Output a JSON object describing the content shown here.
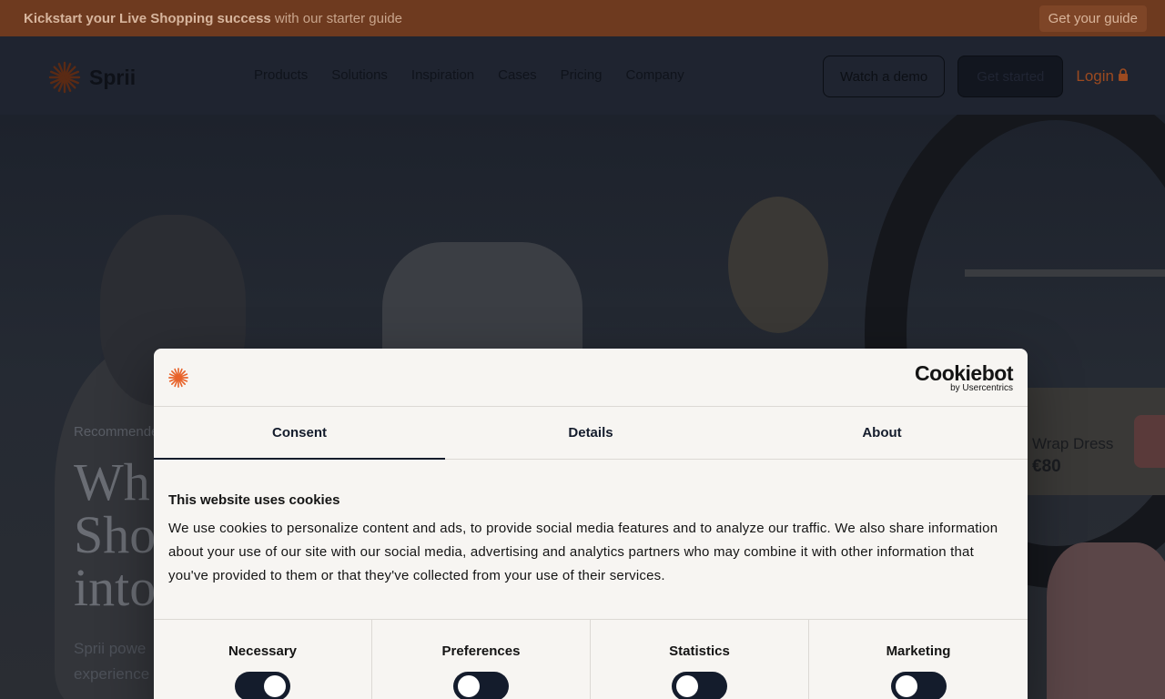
{
  "promo": {
    "bold_text": "Kickstart your Live Shopping success",
    "text": " with our starter guide",
    "cta": "Get your guide"
  },
  "header": {
    "brand": "Sprii",
    "nav": [
      "Products",
      "Solutions",
      "Inspiration",
      "Cases",
      "Pricing",
      "Company"
    ],
    "watch_demo": "Watch a demo",
    "get_started": "Get started",
    "login": "Login"
  },
  "hero": {
    "eyebrow": "Recommended",
    "headline_lines": [
      "Wh",
      "Sho",
      "into"
    ],
    "sub_lines": [
      "Sprii powe",
      "experience"
    ],
    "product_name": "Wrap Dress",
    "product_price": "€80"
  },
  "cookie": {
    "brand": "Cookiebot",
    "brand_sub": "by Usercentrics",
    "tabs": [
      "Consent",
      "Details",
      "About"
    ],
    "active_tab": "Consent",
    "title": "This website uses cookies",
    "text": "We use cookies to personalize content and ads, to provide social media features and to analyze our traffic. We also share information about your use of our site with our social media, advertising and analytics partners who may combine it with other information that you've provided to them or that they've collected from your use of their services.",
    "categories": [
      {
        "label": "Necessary",
        "enabled": true
      },
      {
        "label": "Preferences",
        "enabled": false
      },
      {
        "label": "Statistics",
        "enabled": false
      },
      {
        "label": "Marketing",
        "enabled": false
      }
    ]
  },
  "colors": {
    "accent": "#e8632a",
    "dark": "#141c2c",
    "dialog_bg": "#f7f5f2"
  }
}
